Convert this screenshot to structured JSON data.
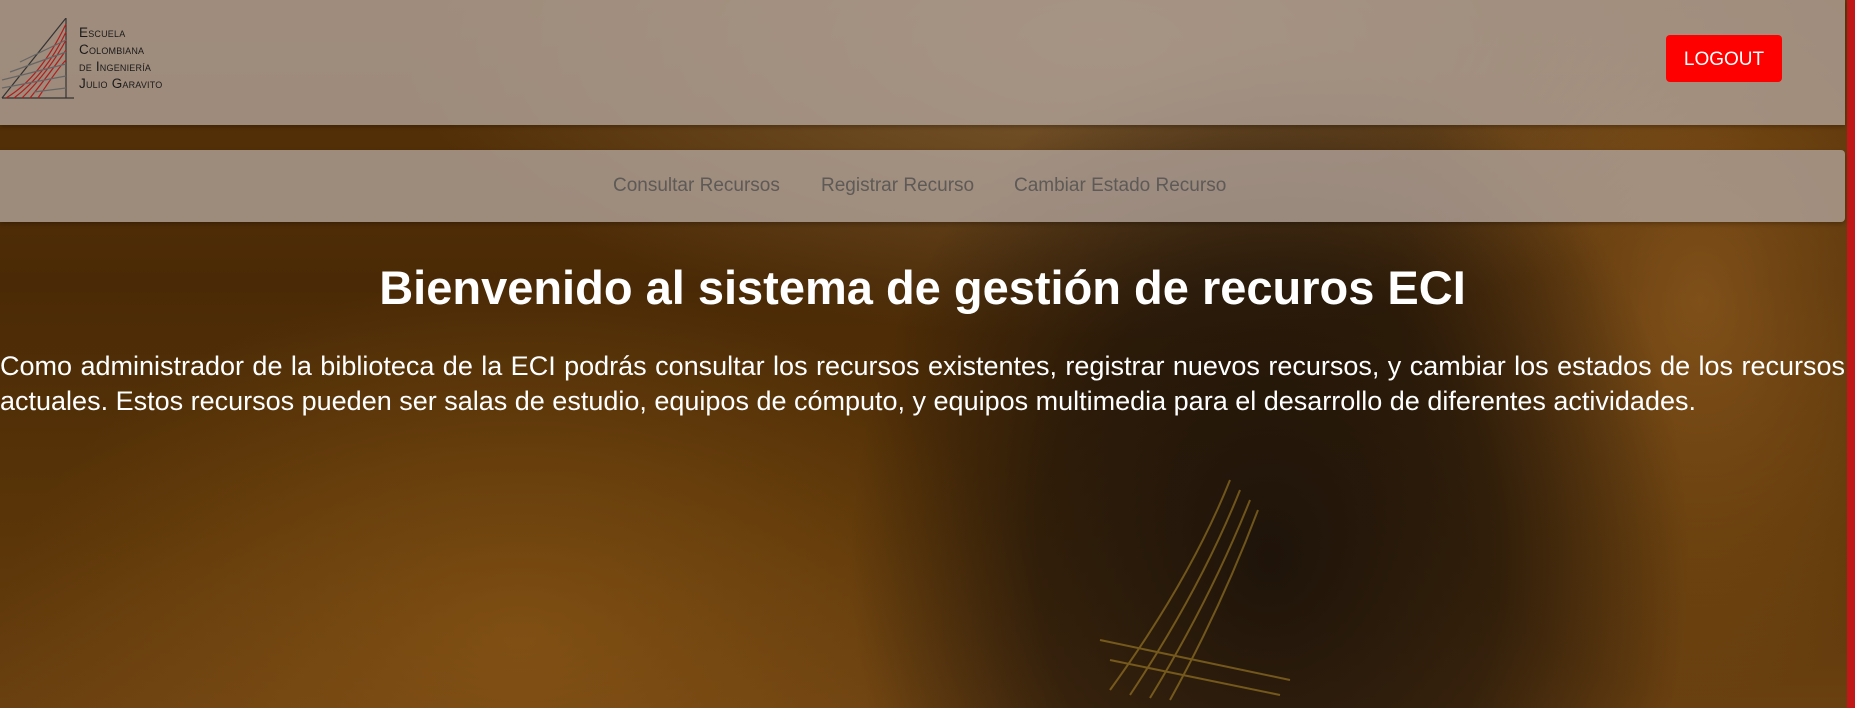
{
  "header": {
    "logo_lines": [
      "Escuela",
      "Colombiana",
      "de Ingeniería",
      "Julio Garavito"
    ],
    "logout_label": "LOGOUT"
  },
  "nav": {
    "items": [
      {
        "label": "Consultar Recursos"
      },
      {
        "label": "Registrar Recurso"
      },
      {
        "label": "Cambiar Estado Recurso"
      }
    ]
  },
  "main": {
    "title": "Bienvenido al sistema de gestión de recuros ECI",
    "description": "Como administrador de la biblioteca de la ECI podrás consultar los recursos existentes, registrar nuevos recursos, y cambiar los estados de los recursos actuales. Estos recursos pueden ser salas de estudio, equipos de cómputo, y equipos multimedia para el desarrollo de diferentes actividades."
  },
  "colors": {
    "logout_bg": "#ff0000",
    "header_bg": "#afa096",
    "accent_edge": "#c01818"
  }
}
